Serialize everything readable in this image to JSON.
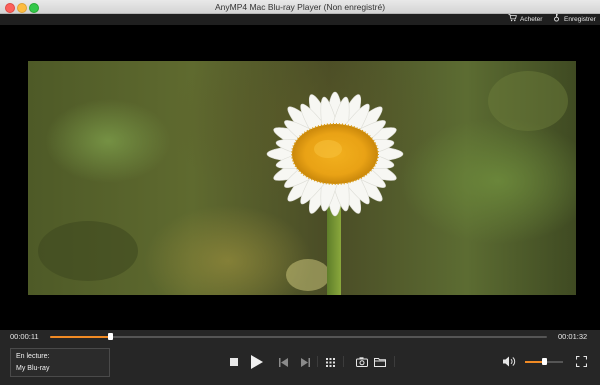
{
  "window": {
    "title": "AnyMP4 Mac Blu-ray Player (Non enregistré)"
  },
  "top_toolbar": {
    "buy_label": "Acheter",
    "register_label": "Enregistrer"
  },
  "playback": {
    "current_time": "00:00:11",
    "total_time": "00:01:32",
    "progress_fraction": 0.12,
    "volume_fraction": 0.5
  },
  "now_playing": {
    "label": "En lecture:",
    "title": "My Blu-ray"
  },
  "colors": {
    "accent": "#f08a24",
    "control_bar": "#262626",
    "video_bg": "#000000"
  },
  "icons": [
    "cart-icon",
    "key-icon",
    "stop-icon",
    "play-icon",
    "previous-icon",
    "next-icon",
    "menu-grid-icon",
    "snapshot-icon",
    "folder-icon",
    "volume-icon",
    "fullscreen-icon"
  ]
}
